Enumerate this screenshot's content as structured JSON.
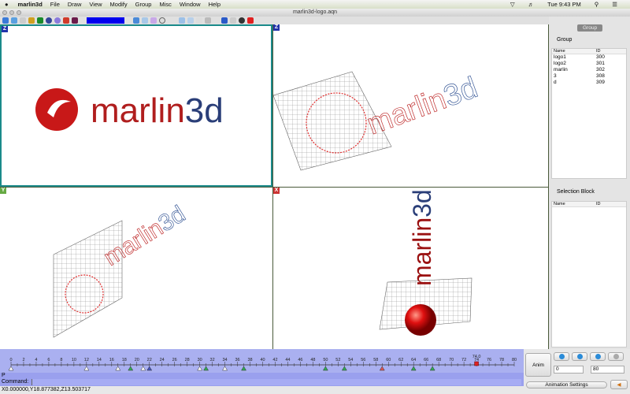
{
  "menubar": {
    "app": "marlin3d",
    "items": [
      "File",
      "Draw",
      "View",
      "Modify",
      "Group",
      "Misc",
      "Window",
      "Help"
    ],
    "clock": "Tue 9:43 PM"
  },
  "window": {
    "title": "marlin3d-logo.aqn"
  },
  "toolbar": {
    "color": "#0000ee"
  },
  "viewports": [
    {
      "axis": "Z",
      "axis_color": "#2233aa",
      "logo": "marlin3d"
    },
    {
      "axis": "Z",
      "axis_color": "#2233aa",
      "logo": "marlin3d"
    },
    {
      "axis": "Y",
      "axis_color": "#66aa44",
      "logo": "marlin3d"
    },
    {
      "axis": "X",
      "axis_color": "#cc3333",
      "logo": "marlin3d"
    }
  ],
  "panel": {
    "tab": "Group",
    "group_title": "Group",
    "columns": [
      "Name",
      "ID"
    ],
    "groups": [
      {
        "name": "logo1",
        "id": "300"
      },
      {
        "name": "logo2",
        "id": "301"
      },
      {
        "name": "marlin",
        "id": "302"
      },
      {
        "name": "3",
        "id": "308"
      },
      {
        "name": "d",
        "id": "309"
      }
    ],
    "selection_title": "Selection Block",
    "selection_columns": [
      "Name",
      "ID"
    ]
  },
  "timeline": {
    "min": 0,
    "max": 80,
    "step": 2,
    "current": 74.0,
    "current_label": "74.0",
    "keyframes": [
      {
        "t": 0,
        "c": "#ffffff"
      },
      {
        "t": 12,
        "c": "#ffffff"
      },
      {
        "t": 17,
        "c": "#ffffff"
      },
      {
        "t": 19,
        "c": "#33aa55"
      },
      {
        "t": 21,
        "c": "#ffffff"
      },
      {
        "t": 22,
        "c": "#4455bb"
      },
      {
        "t": 30,
        "c": "#ffffff"
      },
      {
        "t": 31,
        "c": "#33aa55"
      },
      {
        "t": 34,
        "c": "#ffffff"
      },
      {
        "t": 37,
        "c": "#33aa55"
      },
      {
        "t": 50,
        "c": "#33aa55"
      },
      {
        "t": 53,
        "c": "#33aa55"
      },
      {
        "t": 59,
        "c": "#dd5555"
      },
      {
        "t": 64,
        "c": "#33aa55"
      },
      {
        "t": 67,
        "c": "#33aa55"
      }
    ]
  },
  "command": {
    "mode": "P",
    "label": "Command:",
    "value": ""
  },
  "status": "X0.000000,Y18.877382,Z13.503717",
  "anim": {
    "anim_label": "Anim",
    "start": "0",
    "end": "80",
    "settings_label": "Animation Settings"
  }
}
